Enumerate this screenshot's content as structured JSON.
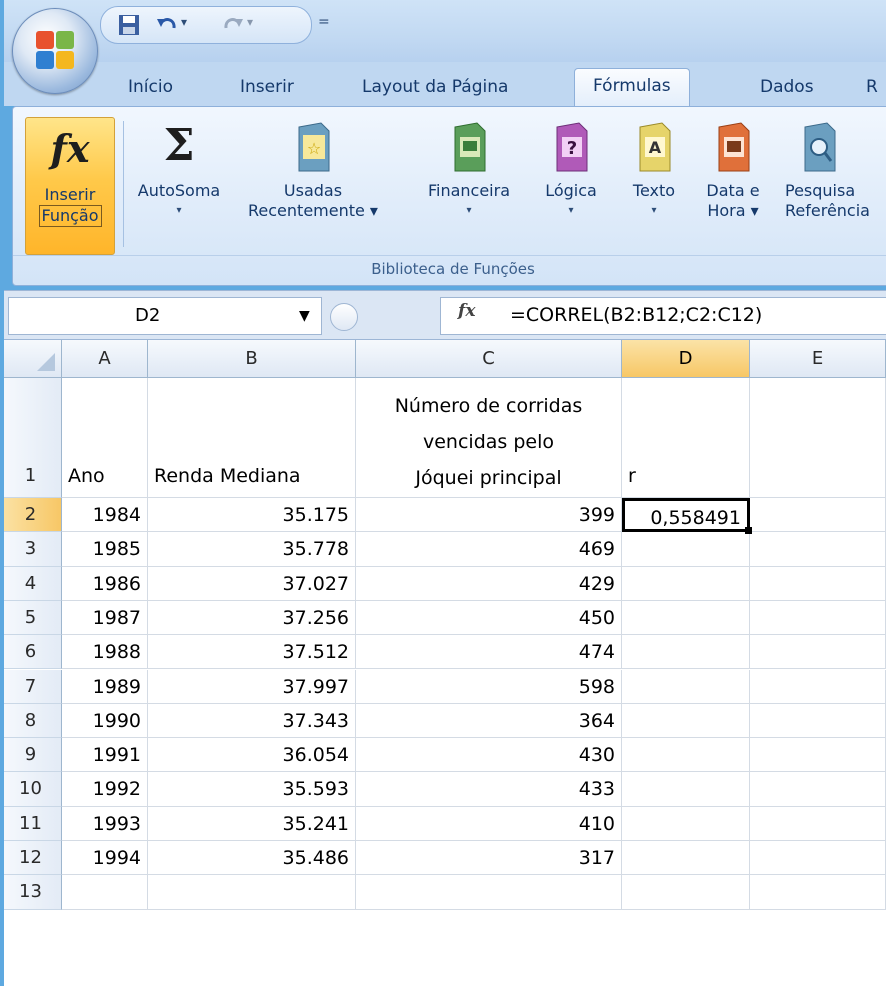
{
  "tabs": [
    "Início",
    "Inserir",
    "Layout da Página",
    "Fórmulas",
    "Dados",
    "R"
  ],
  "ribbon": {
    "insert_function": [
      "Inserir",
      "Função"
    ],
    "buttons": [
      {
        "line1": "AutoSoma",
        "line2": "▾",
        "icon": "sigma-icon"
      },
      {
        "line1": "Usadas",
        "line2": "Recentemente ▾",
        "icon": "recent-book-icon"
      },
      {
        "line1": "Financeira",
        "line2": "▾",
        "icon": "financial-book-icon"
      },
      {
        "line1": "Lógica",
        "line2": "▾",
        "icon": "logical-book-icon"
      },
      {
        "line1": "Texto",
        "line2": "▾",
        "icon": "text-book-icon"
      },
      {
        "line1": "Data e",
        "line2": "Hora ▾",
        "icon": "datetime-book-icon"
      },
      {
        "line1": "Pesquisa",
        "line2": "Referência",
        "icon": "lookup-book-icon"
      }
    ],
    "group_label": "Biblioteca de Funções"
  },
  "formula_bar": {
    "name_box": "D2",
    "fx": "fx",
    "formula": "=CORREL(B2:B12;C2:C12)"
  },
  "columns": [
    "A",
    "B",
    "C",
    "D",
    "E"
  ],
  "header_row": {
    "row": "1",
    "A": "Ano",
    "B": "Renda Mediana",
    "C": [
      "Número de corridas",
      "vencidas pelo",
      "Jóquei principal"
    ],
    "D": "r"
  },
  "rows": [
    {
      "row": "2",
      "A": "1984",
      "B": "35.175",
      "C": "399",
      "D": "0,558491"
    },
    {
      "row": "3",
      "A": "1985",
      "B": "35.778",
      "C": "469",
      "D": ""
    },
    {
      "row": "4",
      "A": "1986",
      "B": "37.027",
      "C": "429",
      "D": ""
    },
    {
      "row": "5",
      "A": "1987",
      "B": "37.256",
      "C": "450",
      "D": ""
    },
    {
      "row": "6",
      "A": "1988",
      "B": "37.512",
      "C": "474",
      "D": ""
    },
    {
      "row": "7",
      "A": "1989",
      "B": "37.997",
      "C": "598",
      "D": ""
    },
    {
      "row": "8",
      "A": "1990",
      "B": "37.343",
      "C": "364",
      "D": ""
    },
    {
      "row": "9",
      "A": "1991",
      "B": "36.054",
      "C": "430",
      "D": ""
    },
    {
      "row": "10",
      "A": "1992",
      "B": "35.593",
      "C": "433",
      "D": ""
    },
    {
      "row": "11",
      "A": "1993",
      "B": "35.241",
      "C": "410",
      "D": ""
    },
    {
      "row": "12",
      "A": "1994",
      "B": "35.486",
      "C": "317",
      "D": ""
    },
    {
      "row": "13",
      "A": "",
      "B": "",
      "C": "",
      "D": ""
    }
  ],
  "selected_cell": "D2"
}
